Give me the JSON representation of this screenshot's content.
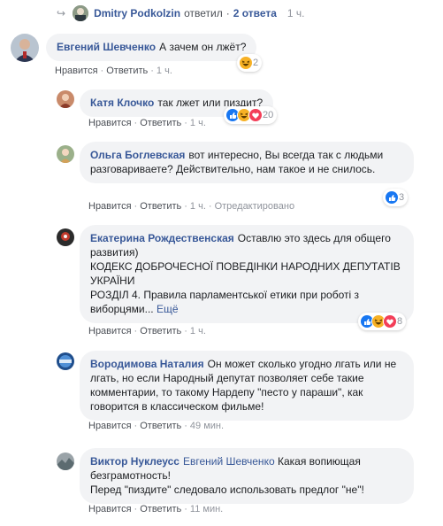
{
  "top_reply": {
    "name": "Dmitry Podkolzin",
    "verb": "ответил",
    "separator": "·",
    "count": "2 ответа",
    "time": "1 ч."
  },
  "actions": {
    "like": "Нравится",
    "reply": "Ответить",
    "sep": "·",
    "edited": "Отредактировано"
  },
  "comments": [
    {
      "author": "Евгений Шевченко",
      "text": "А зачем он лжёт?",
      "time": "1 ч.",
      "reactions_count": "2"
    },
    {
      "author": "Катя Клочко",
      "text": "так лжет или пиздит?",
      "time": "1 ч.",
      "reactions_count": "20"
    },
    {
      "author": "Ольга Боглевская",
      "text": "вот интересно, Вы всегда так с людьми разговариваете? Действительно, нам такое и не снилось.",
      "time": "1 ч.",
      "reactions_count": "3"
    },
    {
      "author": "Екатерина Рождественская",
      "text": "Оставлю это здесь для общего развития)",
      "line2": "КОДЕКС ДОБРОЧЕСНОЇ ПОВЕДІНКИ НАРОДНИХ ДЕПУТАТІВ УКРАЇНИ",
      "line3": "РОЗДІЛ 4. Правила парламентської етики при роботі з виборцями...",
      "more": "Ещё",
      "time": "1 ч.",
      "reactions_count": "8"
    },
    {
      "author": "Вородимова Наталия",
      "text": "Он может сколько угодно лгать или не лгать, но если Народный депутат позволяет себе такие комментарии, то такому Нардепу \"песто у параши\", как говорится в классическом фильме!",
      "time": "49 мин."
    },
    {
      "author": "Виктор Нуклеусс",
      "mention": "Евгений Шевченко",
      "text": "Какая вопиющая безграмотность!",
      "line2": "Перед \"пиздите\" следовало использовать предлог \"не\"!",
      "time": "11 мин."
    }
  ],
  "colors": {
    "link": "#385898",
    "bubble": "#f2f3f5",
    "meta": "#90949c",
    "like_blue": "#1877f2",
    "haha_yellow": "#f7b125",
    "love_red": "#f33e58"
  },
  "icons": {
    "like": "thumbs-up-icon",
    "haha": "laughing-face-icon",
    "love": "heart-icon",
    "reply_arrow": "reply-arrow-icon"
  }
}
